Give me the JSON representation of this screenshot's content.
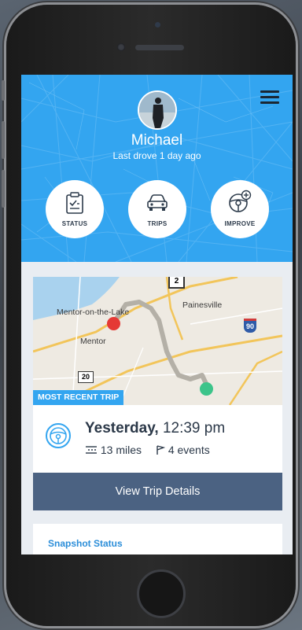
{
  "user": {
    "name": "Michael",
    "last_drove": "Last drove 1 day ago"
  },
  "actions": [
    {
      "label": "STATUS",
      "icon": "clipboard-icon"
    },
    {
      "label": "TRIPS",
      "icon": "car-icon"
    },
    {
      "label": "IMPROVE",
      "icon": "steering-wheel-plus-icon"
    }
  ],
  "map": {
    "labels": {
      "route_2": "2",
      "painesville": "Painesville",
      "mentor_lake": "Mentor-on-the-Lake",
      "mentor": "Mentor",
      "route_90": "90",
      "route_20": "20"
    }
  },
  "trip": {
    "badge": "MOST RECENT TRIP",
    "day": "Yesterday,",
    "time": "12:39 pm",
    "miles": "13 miles",
    "events": "4 events",
    "button": "View Trip Details"
  },
  "snapshot": {
    "title": "Snapshot Status"
  },
  "colors": {
    "header": "#33a5f0",
    "button": "#4b6282",
    "start_pin": "#e53935",
    "end_pin": "#3cc48a",
    "route": "#b4b0a7"
  }
}
